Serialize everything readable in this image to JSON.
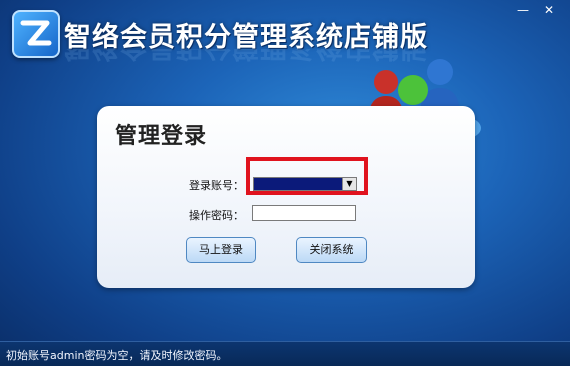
{
  "app": {
    "title": "智络会员积分管理系统店铺版"
  },
  "window_controls": {
    "minimize": "—",
    "close": "✕"
  },
  "login": {
    "heading": "管理登录",
    "account_label": "登录账号：",
    "account_value": "",
    "password_label": "操作密码：",
    "password_value": "",
    "login_button": "马上登录",
    "close_button": "关闭系统"
  },
  "status": {
    "hint": "初始账号admin密码为空，请及时修改密码。"
  },
  "colors": {
    "background": "#1c64b8",
    "highlight_border": "#e0131e",
    "selected_field": "#0b1a7a"
  },
  "icons": {
    "logo": "z-letter-logo",
    "people": "users-group-icon"
  }
}
